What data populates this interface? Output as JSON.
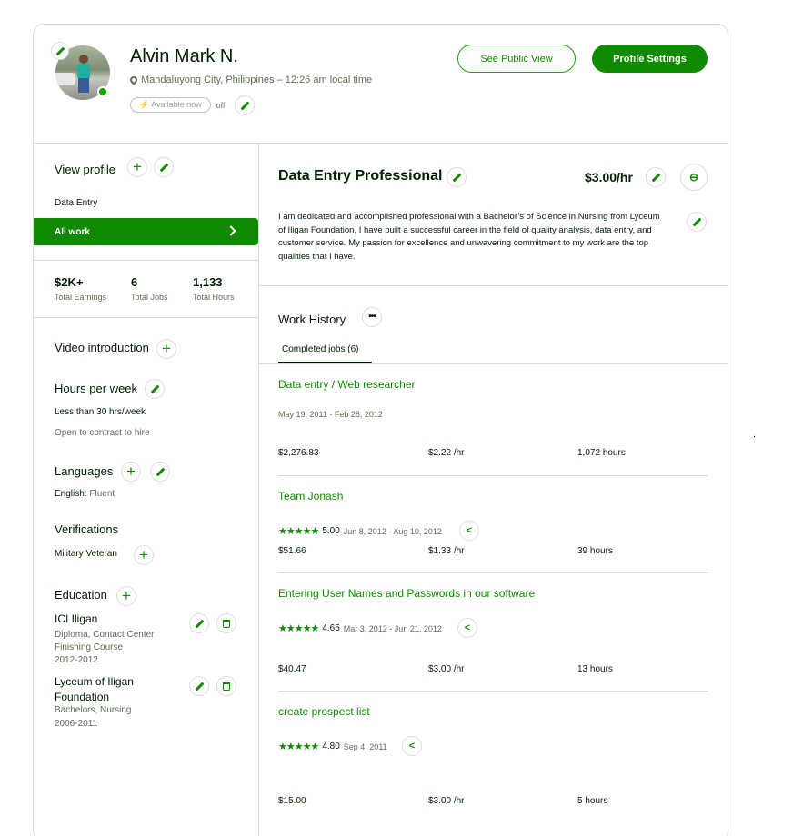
{
  "header": {
    "name": "Alvin Mark N.",
    "location": "Mandaluyong City, Philippines – 12:26 am local time",
    "availability_badge": "Available now",
    "availability_state": "off",
    "see_public_view": "See Public View",
    "profile_settings": "Profile Settings",
    "colors": {
      "brand": "#108a00",
      "border": "#d5e0d5",
      "muted": "#5e6d55"
    }
  },
  "sidebar": {
    "view_profile": "View profile",
    "specialization": "Data Entry",
    "all_work": "All work",
    "stats": [
      {
        "value": "$2K+",
        "label": "Total Earnings"
      },
      {
        "value": "6",
        "label": "Total Jobs"
      },
      {
        "value": "1,133",
        "label": "Total Hours"
      }
    ],
    "video_intro": "Video introduction",
    "hours_per_week": "Hours per week",
    "hours_value": "Less than 30 hrs/week",
    "hours_note": "Open to contract to hire",
    "languages": "Languages",
    "language_name": "English:",
    "language_level": "Fluent",
    "verifications": "Verifications",
    "verification_item": "Military Veteran",
    "education": "Education",
    "education_items": [
      {
        "school": "ICI Iligan",
        "degree": "Diploma, Contact Center Finishing Course",
        "years": "2012-2012"
      },
      {
        "school": "Lyceum of Iligan Foundation",
        "degree": "Bachelors, Nursing",
        "years": "2006-2011"
      }
    ]
  },
  "main": {
    "title": "Data Entry Professional",
    "rate": "$3.00/hr",
    "overview": "I am dedicated and accomplished professional with a Bachelor’s of Science in Nursing from Lyceum of Iligan Foundation, I have built a successful career in the field of quality analysis, data entry, and customer service. My passion for excellence and unwavering commitment to my work are the top qualities that I have.",
    "work_history": "Work History",
    "tab_completed": "Completed jobs (6)",
    "jobs": [
      {
        "title": "Data entry / Web researcher",
        "rating": "",
        "dates": "May 19, 2011 - Feb 28, 2012",
        "earned": "$2,276.83",
        "rate": "$2.22",
        "hours": "1,072"
      },
      {
        "title": "Team Jonash",
        "rating": "5.00",
        "dates": "Jun 8, 2012 - Aug 10, 2012",
        "earned": "$51.66",
        "rate": "$1.33",
        "hours": "39"
      },
      {
        "title": "Entering User Names and Passwords in our software",
        "rating": "4.65",
        "dates": "Mar 3, 2012 - Jun 21, 2012",
        "earned": "$40.47",
        "rate": "$3.00",
        "hours": "13"
      },
      {
        "title": "create prospect list",
        "rating": "4.80",
        "dates": "Sep 4, 2011",
        "earned": "$15.00",
        "rate": "$3.00",
        "hours": "5"
      }
    ],
    "rate_suffix": "/hr",
    "hours_suffix": "hours"
  },
  "stray_mark": "."
}
